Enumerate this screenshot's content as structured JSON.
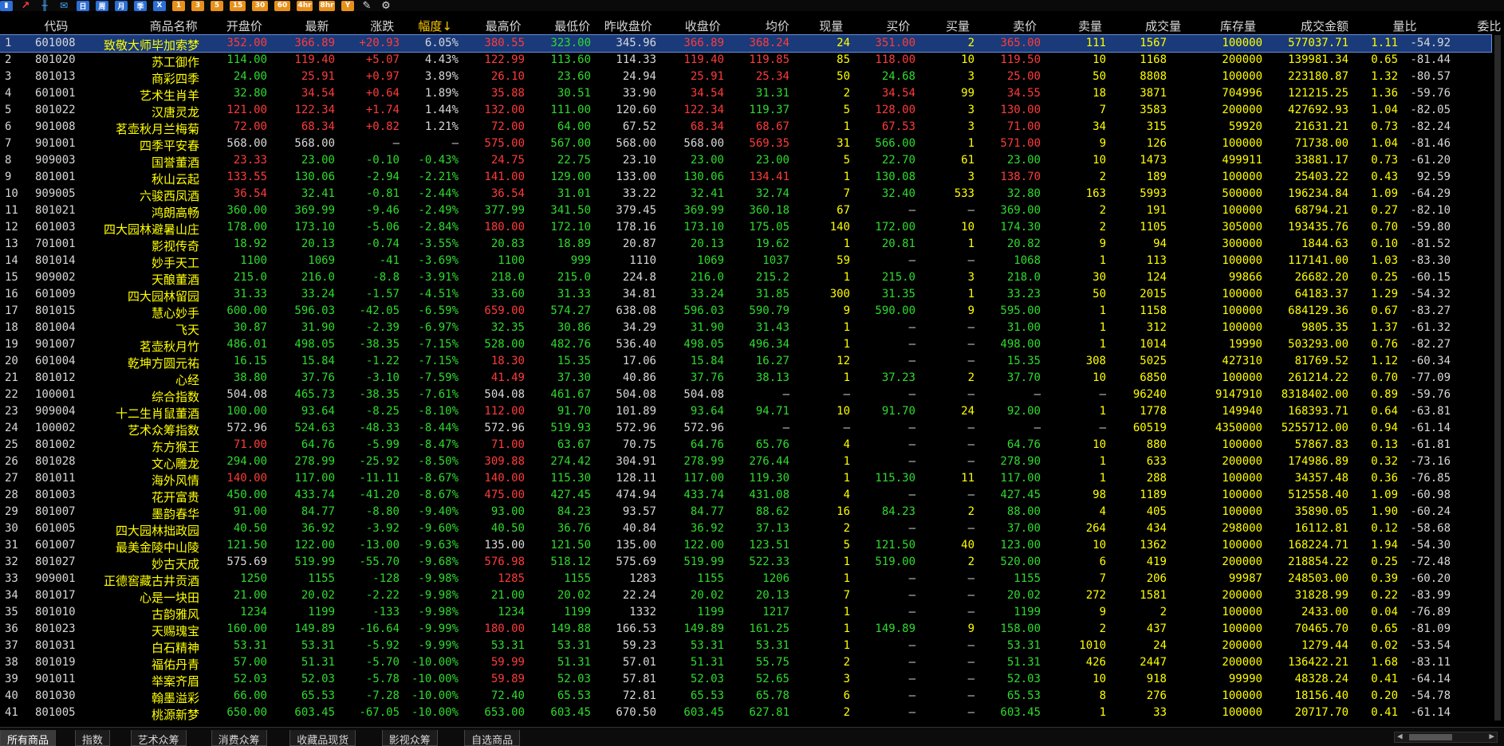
{
  "toolbar": {
    "icons": [
      {
        "name": "kline-chart-icon",
        "glyph": "▮",
        "style": "tb-blue"
      },
      {
        "name": "line-chart-icon",
        "glyph": "↗",
        "style": "tb-red"
      },
      {
        "name": "candlestick-icon",
        "glyph": "╫",
        "style": "tb-cyan"
      },
      {
        "name": "mail-icon",
        "glyph": "✉",
        "style": "tb-cyan"
      },
      {
        "name": "period-day-icon",
        "glyph": "日",
        "style": "tb-blue"
      },
      {
        "name": "period-week-icon",
        "glyph": "周",
        "style": "tb-blue"
      },
      {
        "name": "period-month-icon",
        "glyph": "月",
        "style": "tb-blue"
      },
      {
        "name": "period-season-icon",
        "glyph": "季",
        "style": "tb-blue"
      },
      {
        "name": "period-year-icon",
        "glyph": "X",
        "style": "tb-blue"
      },
      {
        "name": "period-1m-icon",
        "glyph": "1",
        "style": "tb-orange"
      },
      {
        "name": "period-3m-icon",
        "glyph": "3",
        "style": "tb-orange"
      },
      {
        "name": "period-5m-icon",
        "glyph": "5",
        "style": "tb-orange"
      },
      {
        "name": "period-15m-icon",
        "glyph": "15",
        "style": "tb-orange"
      },
      {
        "name": "period-30m-icon",
        "glyph": "30",
        "style": "tb-orange"
      },
      {
        "name": "period-60m-icon",
        "glyph": "60",
        "style": "tb-orange"
      },
      {
        "name": "period-4hr-icon",
        "glyph": "4hr",
        "style": "tb-orange"
      },
      {
        "name": "period-8hr-icon",
        "glyph": "8hr",
        "style": "tb-orange"
      },
      {
        "name": "period-year2-icon",
        "glyph": "Y",
        "style": "tb-orange"
      },
      {
        "name": "draw-tool-icon",
        "glyph": "✎",
        "style": "tb-gear"
      },
      {
        "name": "settings-gear-icon",
        "glyph": "⚙",
        "style": "tb-gear"
      }
    ]
  },
  "columns": [
    "",
    "代码",
    "商品名称",
    "开盘价",
    "最新",
    "涨跌",
    "幅度↓",
    "最高价",
    "最低价",
    "昨收盘价",
    "收盘价",
    "均价",
    "现量",
    "买价",
    "买量",
    "卖价",
    "卖量",
    "成交量",
    "库存量",
    "成交金额",
    "量比",
    "委比 >>"
  ],
  "rows": [
    [
      "1",
      "601008",
      "致敬大师毕加索梦",
      "352.00",
      "366.89",
      "+20.93",
      "6.05%",
      "380.55",
      "323.00",
      "345.96",
      "366.89",
      "368.24",
      "24",
      "351.00",
      "2",
      "365.00",
      "111",
      "1567",
      "100000",
      "577037.71",
      "1.11",
      "-54.92"
    ],
    [
      "2",
      "801020",
      "苏工御作",
      "114.00",
      "119.40",
      "+5.07",
      "4.43%",
      "122.99",
      "113.60",
      "114.33",
      "119.40",
      "119.85",
      "85",
      "118.00",
      "10",
      "119.50",
      "10",
      "1168",
      "200000",
      "139981.34",
      "0.65",
      "-81.44"
    ],
    [
      "3",
      "801013",
      "商彩四季",
      "24.00",
      "25.91",
      "+0.97",
      "3.89%",
      "26.10",
      "23.60",
      "24.94",
      "25.91",
      "25.34",
      "50",
      "24.68",
      "3",
      "25.00",
      "50",
      "8808",
      "100000",
      "223180.87",
      "1.32",
      "-80.57"
    ],
    [
      "4",
      "601001",
      "艺术生肖羊",
      "32.80",
      "34.54",
      "+0.64",
      "1.89%",
      "35.88",
      "30.51",
      "33.90",
      "34.54",
      "31.31",
      "2",
      "34.54",
      "99",
      "34.55",
      "18",
      "3871",
      "704996",
      "121215.25",
      "1.36",
      "-59.76"
    ],
    [
      "5",
      "801022",
      "汉唐灵龙",
      "121.00",
      "122.34",
      "+1.74",
      "1.44%",
      "132.00",
      "111.00",
      "120.60",
      "122.34",
      "119.37",
      "5",
      "128.00",
      "3",
      "130.00",
      "7",
      "3583",
      "200000",
      "427692.93",
      "1.04",
      "-82.05"
    ],
    [
      "6",
      "901008",
      "茗壶秋月兰梅菊",
      "72.00",
      "68.34",
      "+0.82",
      "1.21%",
      "72.00",
      "64.00",
      "67.52",
      "68.34",
      "68.67",
      "1",
      "67.53",
      "3",
      "71.00",
      "34",
      "315",
      "59920",
      "21631.21",
      "0.73",
      "-82.24"
    ],
    [
      "7",
      "901001",
      "四季平安春",
      "568.00",
      "568.00",
      "—",
      "—",
      "575.00",
      "567.00",
      "568.00",
      "568.00",
      "569.35",
      "31",
      "566.00",
      "1",
      "571.00",
      "9",
      "126",
      "100000",
      "71738.00",
      "1.04",
      "-81.46"
    ],
    [
      "8",
      "909003",
      "国誉董酒",
      "23.33",
      "23.00",
      "-0.10",
      "-0.43%",
      "24.75",
      "22.75",
      "23.10",
      "23.00",
      "23.00",
      "5",
      "22.70",
      "61",
      "23.00",
      "10",
      "1473",
      "499911",
      "33881.17",
      "0.73",
      "-61.20"
    ],
    [
      "9",
      "801001",
      "秋山云起",
      "133.55",
      "130.06",
      "-2.94",
      "-2.21%",
      "141.00",
      "129.00",
      "133.00",
      "130.06",
      "134.41",
      "1",
      "130.08",
      "3",
      "138.70",
      "2",
      "189",
      "100000",
      "25403.22",
      "0.43",
      "92.59"
    ],
    [
      "10",
      "909005",
      "六骏西凤酒",
      "36.54",
      "32.41",
      "-0.81",
      "-2.44%",
      "36.54",
      "31.01",
      "33.22",
      "32.41",
      "32.74",
      "7",
      "32.40",
      "533",
      "32.80",
      "163",
      "5993",
      "500000",
      "196234.84",
      "1.09",
      "-64.29"
    ],
    [
      "11",
      "801021",
      "鸿朗高畅",
      "360.00",
      "369.99",
      "-9.46",
      "-2.49%",
      "377.99",
      "341.50",
      "379.45",
      "369.99",
      "360.18",
      "67",
      "—",
      "—",
      "369.00",
      "2",
      "191",
      "100000",
      "68794.21",
      "0.27",
      "-82.10"
    ],
    [
      "12",
      "601003",
      "四大园林避暑山庄",
      "178.00",
      "173.10",
      "-5.06",
      "-2.84%",
      "180.00",
      "172.10",
      "178.16",
      "173.10",
      "175.05",
      "140",
      "172.00",
      "10",
      "174.30",
      "2",
      "1105",
      "305000",
      "193435.76",
      "0.70",
      "-59.80"
    ],
    [
      "13",
      "701001",
      "影视传奇",
      "18.92",
      "20.13",
      "-0.74",
      "-3.55%",
      "20.83",
      "18.89",
      "20.87",
      "20.13",
      "19.62",
      "1",
      "20.81",
      "1",
      "20.82",
      "9",
      "94",
      "300000",
      "1844.63",
      "0.10",
      "-81.52"
    ],
    [
      "14",
      "801014",
      "妙手天工",
      "1100",
      "1069",
      "-41",
      "-3.69%",
      "1100",
      "999",
      "1110",
      "1069",
      "1037",
      "59",
      "—",
      "—",
      "1068",
      "1",
      "113",
      "100000",
      "117141.00",
      "1.03",
      "-83.30"
    ],
    [
      "15",
      "909002",
      "天酿董酒",
      "215.0",
      "216.0",
      "-8.8",
      "-3.91%",
      "218.0",
      "215.0",
      "224.8",
      "216.0",
      "215.2",
      "1",
      "215.0",
      "3",
      "218.0",
      "30",
      "124",
      "99866",
      "26682.20",
      "0.25",
      "-60.15"
    ],
    [
      "16",
      "601009",
      "四大园林留园",
      "31.33",
      "33.24",
      "-1.57",
      "-4.51%",
      "33.60",
      "31.33",
      "34.81",
      "33.24",
      "31.85",
      "300",
      "31.35",
      "1",
      "33.23",
      "50",
      "2015",
      "100000",
      "64183.37",
      "1.29",
      "-54.32"
    ],
    [
      "17",
      "801015",
      "慧心妙手",
      "600.00",
      "596.03",
      "-42.05",
      "-6.59%",
      "659.00",
      "574.27",
      "638.08",
      "596.03",
      "590.79",
      "9",
      "590.00",
      "9",
      "595.00",
      "1",
      "1158",
      "100000",
      "684129.36",
      "0.67",
      "-83.27"
    ],
    [
      "18",
      "801004",
      "飞天",
      "30.87",
      "31.90",
      "-2.39",
      "-6.97%",
      "32.35",
      "30.86",
      "34.29",
      "31.90",
      "31.43",
      "1",
      "—",
      "—",
      "31.00",
      "1",
      "312",
      "100000",
      "9805.35",
      "1.37",
      "-61.32"
    ],
    [
      "19",
      "901007",
      "茗壶秋月竹",
      "486.01",
      "498.05",
      "-38.35",
      "-7.15%",
      "528.00",
      "482.76",
      "536.40",
      "498.05",
      "496.34",
      "1",
      "—",
      "—",
      "498.00",
      "1",
      "1014",
      "19990",
      "503293.00",
      "0.76",
      "-82.27"
    ],
    [
      "20",
      "601004",
      "乾坤方圆元祐",
      "16.15",
      "15.84",
      "-1.22",
      "-7.15%",
      "18.30",
      "15.35",
      "17.06",
      "15.84",
      "16.27",
      "12",
      "—",
      "—",
      "15.35",
      "308",
      "5025",
      "427310",
      "81769.52",
      "1.12",
      "-60.34"
    ],
    [
      "21",
      "801012",
      "心经",
      "38.80",
      "37.76",
      "-3.10",
      "-7.59%",
      "41.49",
      "37.30",
      "40.86",
      "37.76",
      "38.13",
      "1",
      "37.23",
      "2",
      "37.70",
      "10",
      "6850",
      "100000",
      "261214.22",
      "0.70",
      "-77.09"
    ],
    [
      "22",
      "100001",
      "综合指数",
      "504.08",
      "465.73",
      "-38.35",
      "-7.61%",
      "504.08",
      "461.67",
      "504.08",
      "504.08",
      "—",
      "—",
      "—",
      "—",
      "—",
      "—",
      "96240",
      "9147910",
      "8318402.00",
      "0.89",
      "-59.76"
    ],
    [
      "23",
      "909004",
      "十二生肖鼠董酒",
      "100.00",
      "93.64",
      "-8.25",
      "-8.10%",
      "112.00",
      "91.70",
      "101.89",
      "93.64",
      "94.71",
      "10",
      "91.70",
      "24",
      "92.00",
      "1",
      "1778",
      "149940",
      "168393.71",
      "0.64",
      "-63.81"
    ],
    [
      "24",
      "100002",
      "艺术众筹指数",
      "572.96",
      "524.63",
      "-48.33",
      "-8.44%",
      "572.96",
      "519.93",
      "572.96",
      "572.96",
      "—",
      "—",
      "—",
      "—",
      "—",
      "—",
      "60519",
      "4350000",
      "5255712.00",
      "0.94",
      "-61.14"
    ],
    [
      "25",
      "801002",
      "东方猴王",
      "71.00",
      "64.76",
      "-5.99",
      "-8.47%",
      "71.00",
      "63.67",
      "70.75",
      "64.76",
      "65.76",
      "4",
      "—",
      "—",
      "64.76",
      "10",
      "880",
      "100000",
      "57867.83",
      "0.13",
      "-61.81"
    ],
    [
      "26",
      "801028",
      "文心雕龙",
      "294.00",
      "278.99",
      "-25.92",
      "-8.50%",
      "309.88",
      "274.42",
      "304.91",
      "278.99",
      "276.44",
      "1",
      "—",
      "—",
      "278.90",
      "1",
      "633",
      "200000",
      "174986.89",
      "0.32",
      "-73.16"
    ],
    [
      "27",
      "801011",
      "海外风情",
      "140.00",
      "117.00",
      "-11.11",
      "-8.67%",
      "140.00",
      "115.30",
      "128.11",
      "117.00",
      "119.30",
      "1",
      "115.30",
      "11",
      "117.00",
      "1",
      "288",
      "100000",
      "34357.48",
      "0.36",
      "-76.85"
    ],
    [
      "28",
      "801003",
      "花开富贵",
      "450.00",
      "433.74",
      "-41.20",
      "-8.67%",
      "475.00",
      "427.45",
      "474.94",
      "433.74",
      "431.08",
      "4",
      "—",
      "—",
      "427.45",
      "98",
      "1189",
      "100000",
      "512558.40",
      "1.09",
      "-60.98"
    ],
    [
      "29",
      "801007",
      "墨韵春华",
      "91.00",
      "84.77",
      "-8.80",
      "-9.40%",
      "93.00",
      "84.23",
      "93.57",
      "84.77",
      "88.62",
      "16",
      "84.23",
      "2",
      "88.00",
      "4",
      "405",
      "100000",
      "35890.05",
      "1.90",
      "-60.24"
    ],
    [
      "30",
      "601005",
      "四大园林拙政园",
      "40.50",
      "36.92",
      "-3.92",
      "-9.60%",
      "40.50",
      "36.76",
      "40.84",
      "36.92",
      "37.13",
      "2",
      "—",
      "—",
      "37.00",
      "264",
      "434",
      "298000",
      "16112.81",
      "0.12",
      "-58.68"
    ],
    [
      "31",
      "601007",
      "最美金陵中山陵",
      "121.50",
      "122.00",
      "-13.00",
      "-9.63%",
      "135.00",
      "121.50",
      "135.00",
      "122.00",
      "123.51",
      "5",
      "121.50",
      "40",
      "123.00",
      "10",
      "1362",
      "100000",
      "168224.71",
      "1.94",
      "-54.30"
    ],
    [
      "32",
      "801027",
      "妙古天成",
      "575.69",
      "519.99",
      "-55.70",
      "-9.68%",
      "576.98",
      "518.12",
      "575.69",
      "519.99",
      "522.33",
      "1",
      "519.00",
      "2",
      "520.00",
      "6",
      "419",
      "200000",
      "218854.22",
      "0.25",
      "-72.48"
    ],
    [
      "33",
      "909001",
      "正德窖藏古井贡酒",
      "1250",
      "1155",
      "-128",
      "-9.98%",
      "1285",
      "1155",
      "1283",
      "1155",
      "1206",
      "1",
      "—",
      "—",
      "1155",
      "7",
      "206",
      "99987",
      "248503.00",
      "0.39",
      "-60.20"
    ],
    [
      "34",
      "801017",
      "心是一块田",
      "21.00",
      "20.02",
      "-2.22",
      "-9.98%",
      "21.00",
      "20.02",
      "22.24",
      "20.02",
      "20.13",
      "7",
      "—",
      "—",
      "20.02",
      "272",
      "1581",
      "200000",
      "31828.99",
      "0.22",
      "-83.99"
    ],
    [
      "35",
      "801010",
      "古韵雅风",
      "1234",
      "1199",
      "-133",
      "-9.98%",
      "1234",
      "1199",
      "1332",
      "1199",
      "1217",
      "1",
      "—",
      "—",
      "1199",
      "9",
      "2",
      "100000",
      "2433.00",
      "0.04",
      "-76.89"
    ],
    [
      "36",
      "801023",
      "天赐瑰宝",
      "160.00",
      "149.89",
      "-16.64",
      "-9.99%",
      "180.00",
      "149.88",
      "166.53",
      "149.89",
      "161.25",
      "1",
      "149.89",
      "9",
      "158.00",
      "2",
      "437",
      "100000",
      "70465.70",
      "0.65",
      "-81.09"
    ],
    [
      "37",
      "801031",
      "白石精神",
      "53.31",
      "53.31",
      "-5.92",
      "-9.99%",
      "53.31",
      "53.31",
      "59.23",
      "53.31",
      "53.31",
      "1",
      "—",
      "—",
      "53.31",
      "1010",
      "24",
      "200000",
      "1279.44",
      "0.02",
      "-53.54"
    ],
    [
      "38",
      "801019",
      "福佑丹青",
      "57.00",
      "51.31",
      "-5.70",
      "-10.00%",
      "59.99",
      "51.31",
      "57.01",
      "51.31",
      "55.75",
      "2",
      "—",
      "—",
      "51.31",
      "426",
      "2447",
      "200000",
      "136422.21",
      "1.68",
      "-83.11"
    ],
    [
      "39",
      "901011",
      "举案齐眉",
      "52.03",
      "52.03",
      "-5.78",
      "-10.00%",
      "59.89",
      "52.03",
      "57.81",
      "52.03",
      "52.65",
      "3",
      "—",
      "—",
      "52.03",
      "10",
      "918",
      "99990",
      "48328.24",
      "0.41",
      "-64.14"
    ],
    [
      "40",
      "801030",
      "翰墨溢彩",
      "66.00",
      "65.53",
      "-7.28",
      "-10.00%",
      "72.40",
      "65.53",
      "72.81",
      "65.53",
      "65.78",
      "6",
      "—",
      "—",
      "65.53",
      "8",
      "276",
      "100000",
      "18156.40",
      "0.20",
      "-54.78"
    ],
    [
      "41",
      "801005",
      "桃源新梦",
      "650.00",
      "603.45",
      "-67.05",
      "-10.00%",
      "653.00",
      "603.45",
      "670.50",
      "603.45",
      "627.81",
      "2",
      "—",
      "—",
      "603.45",
      "1",
      "33",
      "100000",
      "20717.70",
      "0.41",
      "-61.14"
    ]
  ],
  "tabs": [
    "所有商品",
    "指数",
    "艺术众筹",
    "消费众筹",
    "收藏品现货",
    "影视众筹",
    "自选商品"
  ],
  "active_tab": 0,
  "colors": {
    "up": "#ff3b3b",
    "down": "#2edc2e",
    "flat": "#d8d8d8",
    "name": "#ffff00",
    "selected_row": "#1a3a7a"
  }
}
